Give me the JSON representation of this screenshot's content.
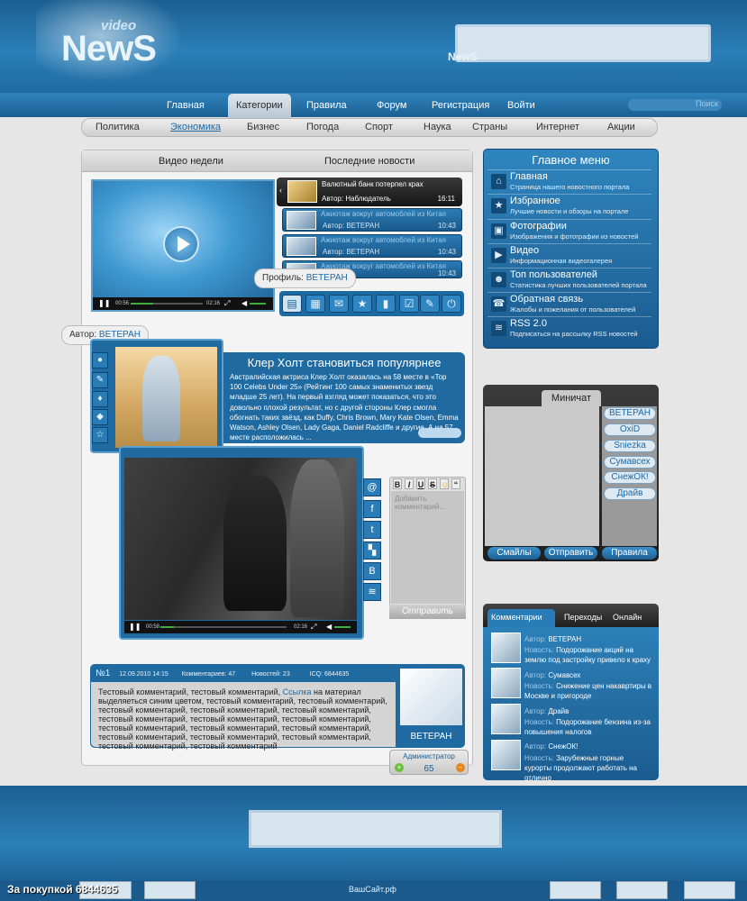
{
  "header": {
    "logo": "NewS",
    "logo_small": "video",
    "banner_label": "NewS"
  },
  "nav": {
    "items": [
      "Главная",
      "Категории",
      "Правила",
      "Форум",
      "Регистрация",
      "Войти"
    ],
    "search_placeholder": "Поиск"
  },
  "subnav": {
    "items": [
      "Политика",
      "Экономика",
      "Бизнес",
      "Погода",
      "Спорт",
      "Наука",
      "Страны",
      "Интернет",
      "Акции"
    ]
  },
  "main_tabs": [
    "Видео недели",
    "Последние новости"
  ],
  "video1": {
    "time_left": "00:56",
    "time_right": "02:16"
  },
  "news_list": [
    {
      "title": "Валютный банк потерпел крах",
      "author": "Автор: Наблюдатель",
      "time": "16:11"
    },
    {
      "title": "Ажиотаж вокруг автомоблей из Китая",
      "author": "Автор: ВЕТЕРАН",
      "time": "10:43"
    },
    {
      "title": "Ажиотаж вокруг автомоблей из Китая",
      "author": "Автор: ВЕТЕРАН",
      "time": "10:43"
    },
    {
      "title": "Ажиотаж вокруг автомоблей из Китая",
      "author": "Автор: ВЕТЕРАН",
      "time": "10:43"
    }
  ],
  "tooltip_profile": {
    "label": "Профиль:",
    "name": "ВЕТЕРАН"
  },
  "tooltip_author": {
    "label": "Автор:",
    "name": "ВЕТЕРАН"
  },
  "article": {
    "title": "Клер Холт становиться популярнее",
    "text": "Австралийская актриса Клер Холт оказалась на 58 месте в «Top 100 Celebs Under 25» (Рейтинг 100 самых знаменитых звезд младше 25 лет). На первый взгляд может показаться, что это довольно плохой результат, но с другой стороны Клер смогла обогнать таких звёзд, как Duffy, Chris Brown, Mary Kate Olsen, Emma Watson, Ashley Olsen, Lady Gaga, Daniel Radcliffe и другие. А на 57 месте расположилась ..."
  },
  "video2": {
    "time_left": "00:58",
    "time_right": "02:16"
  },
  "comment_form": {
    "placeholder": "Добавить комментарий...",
    "send": "Отправить"
  },
  "comment": {
    "number": "№1",
    "date": "12.09.2010 14:15",
    "comments": "Комментариев: 47",
    "news": "Новостей: 23",
    "icq": "ICQ: 6844635",
    "text_a": "Тестовый комментарий, тестовый комментарий,",
    "link": "Ссылка",
    "text_b": "на материал выделяеться синим цветом, тестовый комментарий, тестовый комментарий, тестовый комментарий, тестовый комментарий, тестовый комментарий, тестовый комментарий, тестовый комментарий, тестовый комментарий, тестовый комментарий, тестовый комментарий, тестовый комментарий, тестовый комментарий, тестовый комментарий, тестовый комментарий, тестовый комментарий, тестовый комментарий",
    "user": "ВЕТЕРАН",
    "role": "Администратор",
    "rating": "65"
  },
  "main_menu": {
    "title": "Главное меню",
    "items": [
      {
        "title": "Главная",
        "desc": "Страница нашего новостного портала"
      },
      {
        "title": "Избранное",
        "desc": "Лучшие новости и обзоры на портале"
      },
      {
        "title": "Фотографии",
        "desc": "Изображения и фотографии из новостей"
      },
      {
        "title": "Видео",
        "desc": "Информационная видеогалерея"
      },
      {
        "title": "Топ пользователей",
        "desc": "Статистика лучших пользователей портала"
      },
      {
        "title": "Обратная связь",
        "desc": "Жалобы и пожелания от пользователей"
      },
      {
        "title": "RSS 2.0",
        "desc": "Подписаться на рассылку RSS новостей"
      }
    ]
  },
  "chat": {
    "title": "Миничат",
    "users": [
      "ВЕТЕРАН",
      "OxiD",
      "Sniezka",
      "Сумавсех",
      "СнежОК!",
      "Драйв"
    ],
    "smiles": "Смайлы",
    "send": "Отправить",
    "rules": "Правила"
  },
  "side_tabs": {
    "tabs": [
      "Комментарии",
      "Переходы",
      "Онлайн"
    ],
    "items": [
      {
        "author": "ВЕТЕРАН",
        "news": "Подорожание акций на землю под застройку привело к краху"
      },
      {
        "author": "Сумавсех",
        "news": "Снижение цен накавртиры в Москве и пригороде"
      },
      {
        "author": "Драйв",
        "news": "Подорожание бензина из-за повышения налогов"
      },
      {
        "author": "СнежОК!",
        "news": "Зарубежные горные курорты продолжают работать на отлично"
      }
    ],
    "author_label": "Автор:",
    "news_label": "Новость:"
  },
  "footer": {
    "left_text": "За покупкой 6844635",
    "site": "ВашСайт.рф"
  }
}
